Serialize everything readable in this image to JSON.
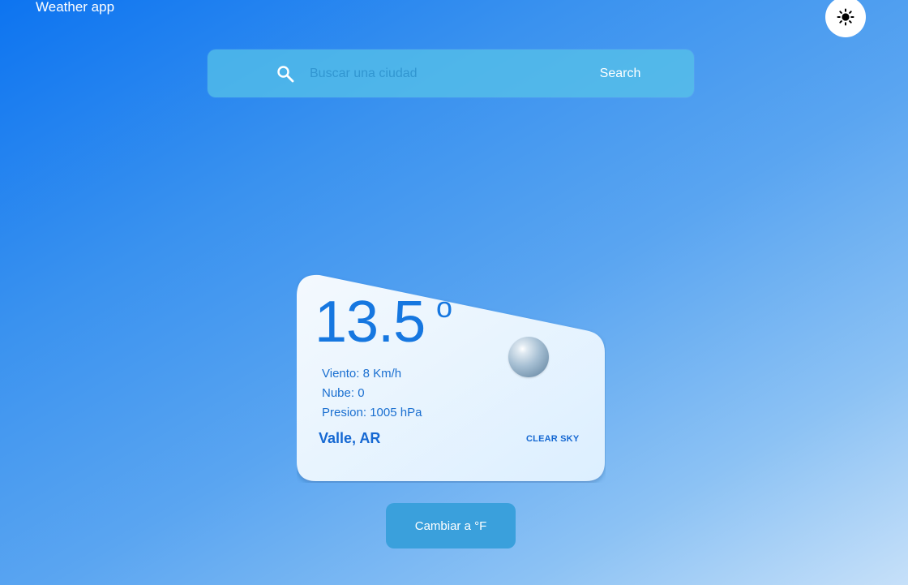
{
  "header": {
    "app_title": "Weather app",
    "theme_toggle_icon": "sun-icon"
  },
  "search": {
    "placeholder": "Buscar una ciudad",
    "value": "",
    "button_label": "Search",
    "icon": "search-icon"
  },
  "weather": {
    "temperature": "13.5",
    "degree_symbol": "o",
    "wind": "Viento: 8 Km/h",
    "clouds": "Nube: 0",
    "pressure": "Presion: 1005 hPa",
    "location": "Valle, AR",
    "condition": "CLEAR SKY",
    "icon": "clear-sky-sphere-icon"
  },
  "actions": {
    "unit_toggle_label": "Cambiar a °F"
  },
  "colors": {
    "background_start": "#0d74f0",
    "background_end": "#c6e0f9",
    "accent": "#1677e0",
    "search_bar": "#58c4e8",
    "unit_button": "#3aa0dc",
    "card_fill": "#e6f3fd"
  }
}
